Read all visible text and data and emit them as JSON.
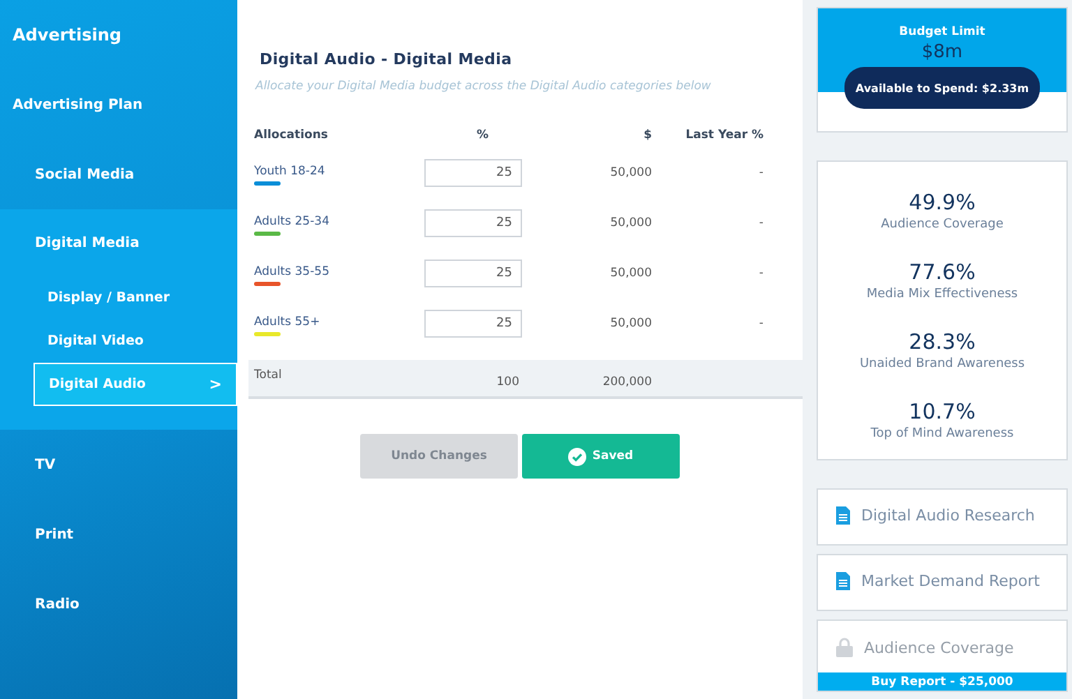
{
  "sidebar": {
    "title": "Advertising",
    "items": [
      {
        "label": "Advertising Plan",
        "selected": false,
        "children": [
          {
            "label": "Social Media",
            "selected": false
          },
          {
            "label": "Digital Media",
            "selected": false,
            "expanded": true,
            "children": [
              {
                "label": "Display / Banner",
                "selected": false
              },
              {
                "label": "Digital Video",
                "selected": false
              },
              {
                "label": "Digital Audio",
                "selected": true,
                "chevron": ">"
              }
            ]
          },
          {
            "label": "TV",
            "selected": false
          },
          {
            "label": "Print",
            "selected": false
          },
          {
            "label": "Radio",
            "selected": false
          }
        ]
      }
    ]
  },
  "main": {
    "title": "Digital Audio - Digital Media",
    "subtitle": "Allocate your Digital Media budget across the Digital Audio categories below",
    "table": {
      "columns": [
        "Allocations",
        "%",
        "$",
        "Last Year %"
      ],
      "rows": [
        {
          "name": "Youth 18-24",
          "color": "#0a8ed8",
          "percent": "25",
          "amount": "50,000",
          "last_year": "-"
        },
        {
          "name": "Adults 25-34",
          "color": "#5ab946",
          "percent": "25",
          "amount": "50,000",
          "last_year": "-"
        },
        {
          "name": "Adults 35-55",
          "color": "#e8542a",
          "percent": "25",
          "amount": "50,000",
          "last_year": "-"
        },
        {
          "name": "Adults 55+",
          "color": "#e8e82a",
          "percent": "25",
          "amount": "50,000",
          "last_year": "-"
        }
      ],
      "total": {
        "label": "Total",
        "percent": "100",
        "amount": "200,000"
      }
    },
    "buttons": [
      {
        "label": "Undo Changes",
        "disabled": true,
        "kind": "undo"
      },
      {
        "label": "Saved",
        "disabled": false,
        "kind": "saved"
      }
    ]
  },
  "budget": {
    "title": "Budget Limit",
    "amount": "$8m",
    "available": "Available to Spend: $2.33m"
  },
  "metrics": [
    {
      "value": "49.9%",
      "label": "Audience Coverage"
    },
    {
      "value": "77.6%",
      "label": "Media Mix Effectiveness"
    },
    {
      "value": "28.3%",
      "label": "Unaided Brand Awareness"
    },
    {
      "value": "10.7%",
      "label": "Top of Mind Awareness"
    }
  ],
  "reports": [
    {
      "kind": "document",
      "label": "Digital Audio Research"
    },
    {
      "kind": "document",
      "label": "Market Demand Report"
    },
    {
      "kind": "locked",
      "label": "Audience Coverage",
      "buy": "Buy Report - $25,000"
    }
  ]
}
